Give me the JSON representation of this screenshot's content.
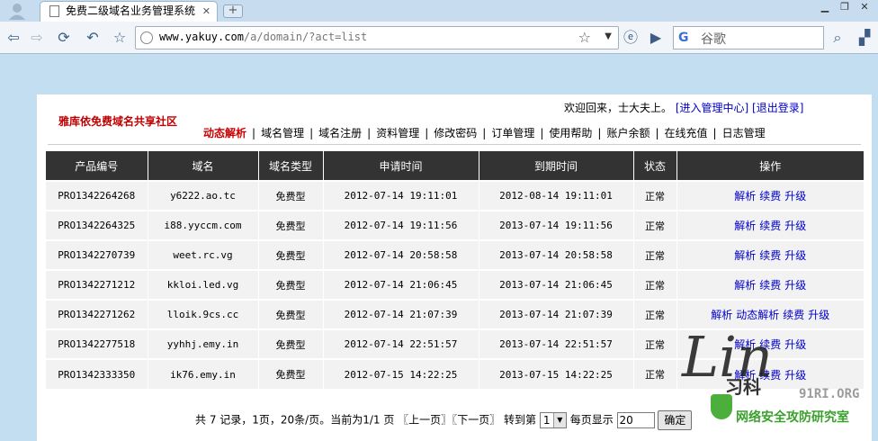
{
  "browser": {
    "tab_title": "免费二级域名业务管理系统",
    "url_host": "www.yakuy.com",
    "url_path": "/a/domain/?act=list",
    "search_placeholder": "谷歌"
  },
  "site": {
    "title": "雅库依免费域名共享社区",
    "welcome": "欢迎回来，士大夫上。",
    "admin_link": "[进入管理中心]",
    "logout_link": "[退出登录]"
  },
  "nav": {
    "items": [
      "动态解析",
      "域名管理",
      "域名注册",
      "资料管理",
      "修改密码",
      "订单管理",
      "使用帮助",
      "账户余额",
      "在线充值",
      "日志管理"
    ],
    "separator": "|"
  },
  "table": {
    "headers": [
      "产品编号",
      "域名",
      "域名类型",
      "申请时间",
      "到期时间",
      "状态",
      "操作"
    ],
    "rows": [
      {
        "id": "PRO1342264268",
        "domain": "y6222.ao.tc",
        "type": "免费型",
        "apply": "2012-07-14 19:11:01",
        "expire": "2012-08-14 19:11:01",
        "status": "正常",
        "ops": [
          "解析",
          "续费",
          "升级"
        ]
      },
      {
        "id": "PRO1342264325",
        "domain": "i88.yyccm.com",
        "type": "免费型",
        "apply": "2012-07-14 19:11:56",
        "expire": "2013-07-14 19:11:56",
        "status": "正常",
        "ops": [
          "解析",
          "续费",
          "升级"
        ]
      },
      {
        "id": "PRO1342270739",
        "domain": "weet.rc.vg",
        "type": "免费型",
        "apply": "2012-07-14 20:58:58",
        "expire": "2013-07-14 20:58:58",
        "status": "正常",
        "ops": [
          "解析",
          "续费",
          "升级"
        ]
      },
      {
        "id": "PRO1342271212",
        "domain": "kkloi.led.vg",
        "type": "免费型",
        "apply": "2012-07-14 21:06:45",
        "expire": "2013-07-14 21:06:45",
        "status": "正常",
        "ops": [
          "解析",
          "续费",
          "升级"
        ]
      },
      {
        "id": "PRO1342271262",
        "domain": "lloik.9cs.cc",
        "type": "免费型",
        "apply": "2012-07-14 21:07:39",
        "expire": "2013-07-14 21:07:39",
        "status": "正常",
        "ops": [
          "解析",
          "动态解析",
          "续费",
          "升级"
        ]
      },
      {
        "id": "PRO1342277518",
        "domain": "yyhhj.emy.in",
        "type": "免费型",
        "apply": "2012-07-14 22:51:57",
        "expire": "2013-07-14 22:51:57",
        "status": "正常",
        "ops": [
          "解析",
          "续费",
          "升级"
        ]
      },
      {
        "id": "PRO1342333350",
        "domain": "ik76.emy.in",
        "type": "免费型",
        "apply": "2012-07-15 14:22:25",
        "expire": "2013-07-15 14:22:25",
        "status": "正常",
        "ops": [
          "解析",
          "续费",
          "升级"
        ]
      }
    ]
  },
  "pager": {
    "summary": "共 7 记录，1页，20条/页。当前为1/1 页",
    "prev": "〖上一页〗",
    "next": "〖下一页〗",
    "goto_label": "转到第",
    "goto_value": "1",
    "per_page_label": "每页显示",
    "per_page_value": "20",
    "confirm": "确定"
  },
  "watermark": {
    "sig": "Lin",
    "cn1": "习科",
    "url": "91RI.ORG",
    "cn2": "网络安全攻防研究室"
  },
  "colors": {
    "page_bg": "#c3def1",
    "header_bg": "#333333",
    "row_bg": "#f2f2f2",
    "link": "#0000cc",
    "accent_red": "#cc0000"
  }
}
